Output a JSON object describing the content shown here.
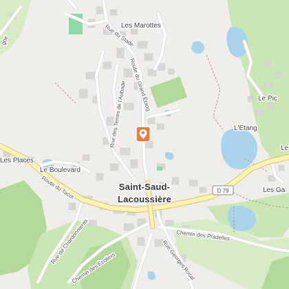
{
  "map": {
    "place_labels": {
      "les_marottes": "Les Marottes",
      "le_pic": "Le Pic",
      "l_etang": "L'Etang",
      "les_places": "Les Places",
      "le_boulevard": "Le Boulevard",
      "les_ga": "Les Ga",
      "le": "Le"
    },
    "town_name_line1": "Saint-Saud-",
    "town_name_line2": "Lacoussière",
    "road_shield": "D 79",
    "street_labels": {
      "rue_du_stade": "Rue du Stade",
      "route_grand_etang": "Route du Grand Étang",
      "rue_terres_aubade": "Rue des Terres de l'Aubade",
      "route_du_tacot": "Route du Tacot",
      "rue_de_chardonnieras": "Rue de Chardonnieras",
      "chemin_des_ecoliers": "Chemin des Écoliers",
      "rue_georges_rocal": "Rue Georges Rocal",
      "chemin_des_pradelles": "Chemin des Pradelles",
      "gne_fragment": "gne"
    },
    "marker": {
      "icon": "map-pin-icon",
      "color": "#f07a3a"
    },
    "colors": {
      "background": "#efeeea",
      "forest": "#c9e6b4",
      "forest_dark": "#b3d99a",
      "water": "#a9d3ea",
      "building": "#d7d7d4",
      "main_road": "#fbf2b4",
      "road": "#ffffff",
      "sports": "#8ed9a8"
    }
  }
}
